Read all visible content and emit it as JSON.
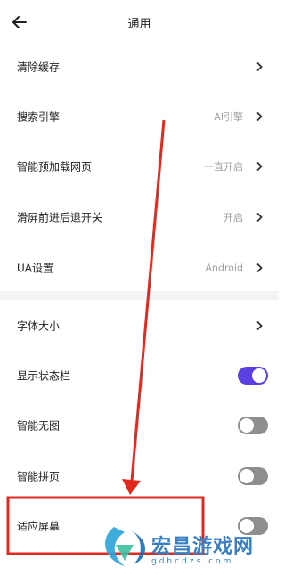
{
  "header": {
    "title": "通用",
    "back_icon": "arrow-left-icon"
  },
  "rows": [
    {
      "label": "清除缓存",
      "value": ""
    },
    {
      "label": "搜索引擎",
      "value": "AI引擎"
    },
    {
      "label": "智能预加载网页",
      "value": "一直开启"
    },
    {
      "label": "滑屏前进后退开关",
      "value": "开启"
    },
    {
      "label": "UA设置",
      "value": "Android"
    },
    {
      "label": "字体大小",
      "value": ""
    }
  ],
  "toggles": [
    {
      "label": "显示状态栏",
      "state": "on"
    },
    {
      "label": "智能无图",
      "state": "off"
    },
    {
      "label": "智能拼页",
      "state": "off"
    },
    {
      "label": "适应屏幕",
      "state": "off"
    }
  ],
  "colors": {
    "toggle_on": "#5b3fe0",
    "toggle_off": "#8e8e8e",
    "annotation_red": "#e02a20",
    "watermark_blue": "#3a7fc4"
  },
  "watermark": {
    "text": "宏昌游戏网",
    "url": "gdhcdzs.com"
  }
}
